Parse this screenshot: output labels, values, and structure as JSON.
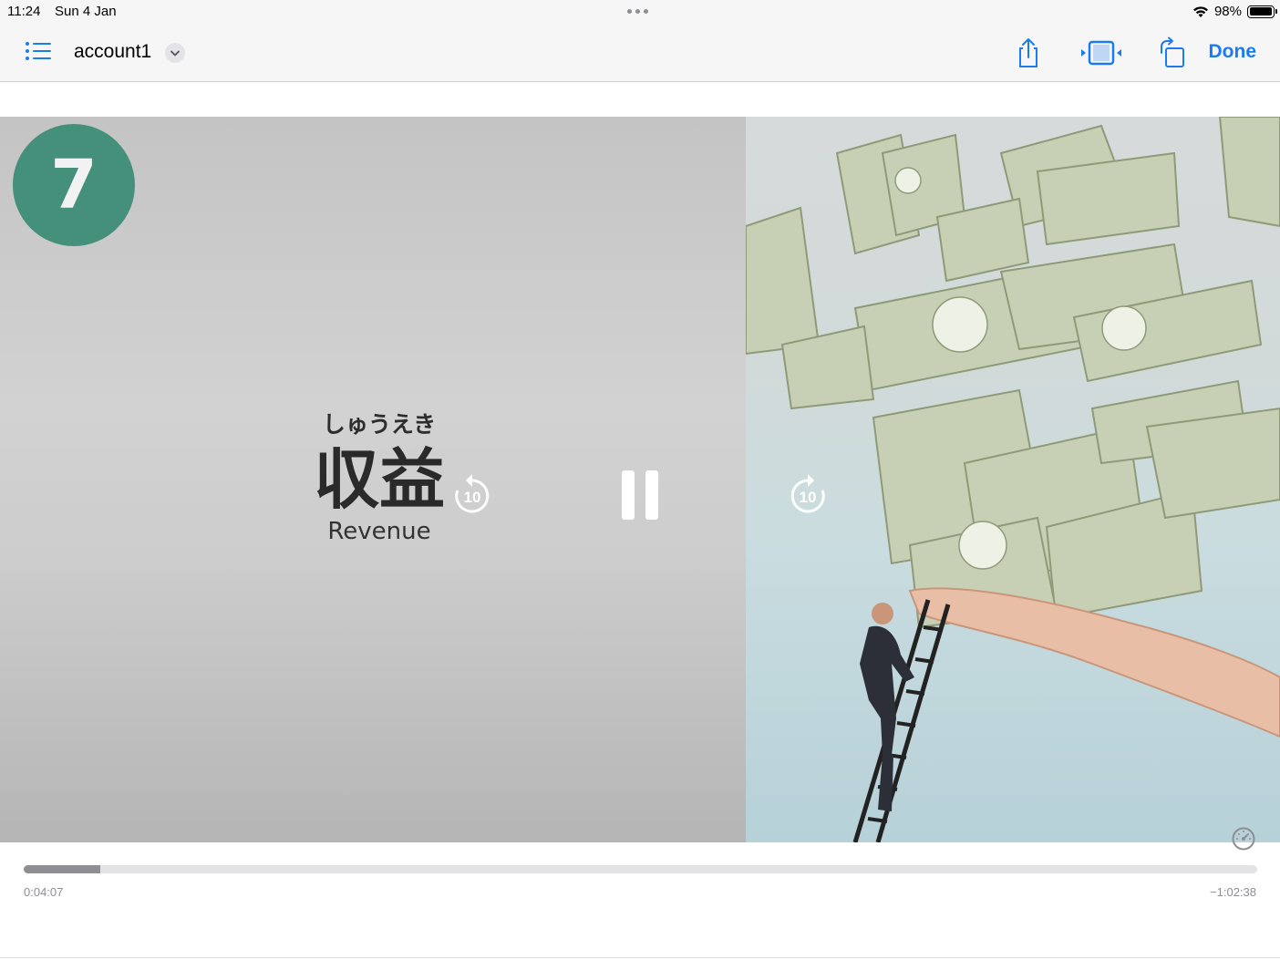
{
  "status_bar": {
    "time": "11:24",
    "date": "Sun 4 Jan",
    "battery_text": "98%",
    "battery_level": 0.98
  },
  "nav": {
    "title": "account1",
    "done_label": "Done",
    "icons": [
      "list-icon",
      "chevron-down-icon",
      "share-icon",
      "picture-in-picture-icon",
      "rotate-icon"
    ],
    "accent_color": "#1a7cf0"
  },
  "video": {
    "slide_number": "7",
    "furigana": "しゅうえき",
    "kanji": "収益",
    "english": "Revenue",
    "skip_back_seconds": "10",
    "skip_forward_seconds": "10",
    "state": "playing",
    "badge_color": "#45907a"
  },
  "playback": {
    "elapsed": "0:04:07",
    "remaining": "−1:02:38",
    "progress": 0.0618
  }
}
